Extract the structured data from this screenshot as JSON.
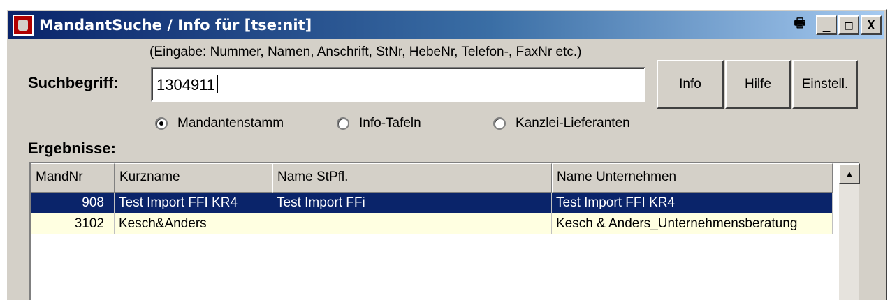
{
  "window": {
    "title": "MandantSuche / Info für [tse:nit]",
    "controls": {
      "printer": "🖶",
      "minimize": "_",
      "maximize": "□",
      "close": "X"
    }
  },
  "search": {
    "hint": "(Eingabe: Nummer, Namen, Anschrift, StNr, HebeNr, Telefon-, FaxNr etc.)",
    "label": "Suchbegriff:",
    "value": "1304911"
  },
  "buttons": {
    "info": "Info",
    "hilfe": "Hilfe",
    "einstellungen": "Einstell."
  },
  "radio": {
    "options": [
      "Mandantenstamm",
      "Info-Tafeln",
      "Kanzlei-Lieferanten"
    ],
    "selected": "Mandantenstamm"
  },
  "results": {
    "label": "Ergebnisse:",
    "columns": [
      "MandNr",
      "Kurzname",
      "Name StPfl.",
      "Name Unternehmen"
    ],
    "rows": [
      [
        "908",
        "Test Import FFI KR4",
        "Test Import FFi",
        "Test Import FFI KR4"
      ],
      [
        "3102",
        "Kesch&Anders",
        "",
        "Kesch & Anders_Unternehmensberatung"
      ]
    ],
    "selected_row": 0
  },
  "colors": {
    "title_start": "#0a246a",
    "title_end": "#a6caf0",
    "selection": "#0a246a",
    "alt_row": "#ffffe1",
    "face": "#d4d0c8"
  }
}
